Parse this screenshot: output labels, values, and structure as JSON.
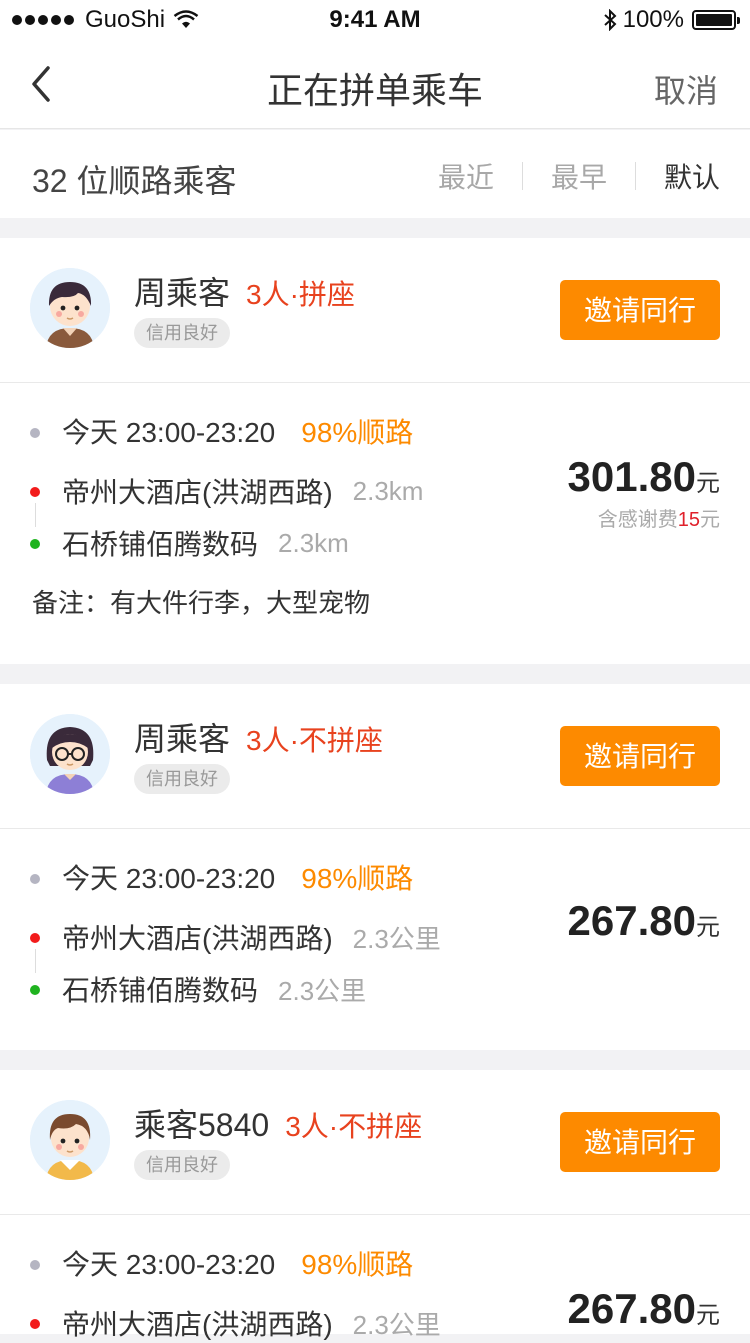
{
  "status_bar": {
    "carrier": "GuoShi",
    "time": "9:41 AM",
    "battery": "100%"
  },
  "nav": {
    "title": "正在拼单乘车",
    "cancel": "取消"
  },
  "filter": {
    "count_text": "32 位顺路乘客",
    "sort_options": [
      "最近",
      "最早",
      "默认"
    ]
  },
  "cards": [
    {
      "name": "周乘客",
      "seat": "3人·拼座",
      "credit": "信用良好",
      "invite": "邀请同行",
      "time": "今天 23:00-23:20",
      "match": "98%顺路",
      "from": "帝州大酒店(洪湖西路)",
      "from_dist": "2.3km",
      "to": "石桥铺佰腾数码",
      "to_dist": "2.3km",
      "note": "备注：有大件行李，大型宠物",
      "price": "301.80",
      "unit": "元",
      "tip_pre": "含感谢费",
      "tip_amount": "15",
      "tip_unit": "元"
    },
    {
      "name": "周乘客",
      "seat": "3人·不拼座",
      "credit": "信用良好",
      "invite": "邀请同行",
      "time": "今天 23:00-23:20",
      "match": "98%顺路",
      "from": "帝州大酒店(洪湖西路)",
      "from_dist": "2.3公里",
      "to": "石桥铺佰腾数码",
      "to_dist": "2.3公里",
      "price": "267.80",
      "unit": "元"
    },
    {
      "name": "乘客5840",
      "seat": "3人·不拼座",
      "credit": "信用良好",
      "invite": "邀请同行",
      "time": "今天 23:00-23:20",
      "match": "98%顺路",
      "from": "帝州大酒店(洪湖西路)",
      "from_dist": "2.3公里",
      "price": "267.80",
      "unit": "元"
    }
  ],
  "colors": {
    "accent": "#fd8a00",
    "seat_red": "#e8421e",
    "from_dot": "#f21b1b",
    "to_dot": "#1fb31f"
  }
}
